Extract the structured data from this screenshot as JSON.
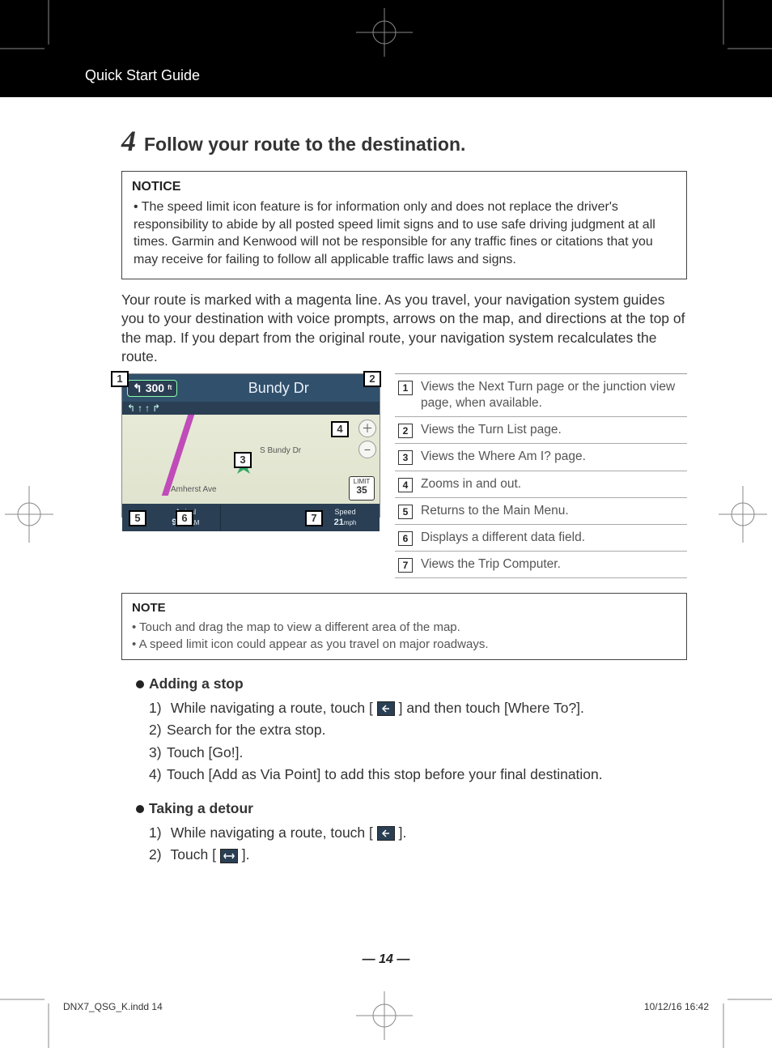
{
  "header": {
    "section": "Quick Start Guide"
  },
  "step": {
    "num": "4",
    "title": "Follow your route to the destination."
  },
  "notice": {
    "title": "NOTICE",
    "items": [
      "The speed limit icon feature is for information only and does not replace the driver's responsibility to abide by all posted speed limit signs and to use safe driving judgment at all times. Garmin and Kenwood will not be responsible for any traffic fines or citations that you may receive for failing to follow all applicable traffic laws and signs."
    ]
  },
  "intro": "Your route is marked with a magenta line. As you travel, your navigation system guides you to your destination with voice prompts, arrows on the map, and directions at the top of the map. If you depart from the original route, your navigation system recalculates the route.",
  "map": {
    "distance": "300",
    "distance_unit": "ft",
    "street": "Bundy Dr",
    "road1": "S Bundy Dr",
    "road2": "Amherst Ave",
    "arrival_lbl": "Arrival",
    "arrival_val": "9:13",
    "arrival_ampm": "AM",
    "speed_lbl": "Speed",
    "speed_val": "21",
    "speed_unit": "mph",
    "limit_lbl": "LIMIT",
    "limit_val": "35",
    "callouts": [
      "1",
      "2",
      "3",
      "4",
      "5",
      "6",
      "7"
    ]
  },
  "legend": [
    "Views the Next Turn page or the junction view page, when available.",
    "Views the Turn List page.",
    "Views the Where Am I? page.",
    "Zooms in and out.",
    "Returns to the Main Menu.",
    "Displays a different data field.",
    "Views the Trip Computer."
  ],
  "note": {
    "title": "NOTE",
    "items": [
      "Touch and drag the map to view a different area of the map.",
      "A speed limit icon could appear as you travel on major roadways."
    ]
  },
  "adding_stop": {
    "title": "Adding a stop",
    "steps_pre": "While navigating a route, touch [",
    "steps_post": "] and then touch [Where To?].",
    "s2": "Search for the extra stop.",
    "s3": "Touch [Go!].",
    "s4": "Touch [Add as Via Point] to add this stop before your final destination."
  },
  "detour": {
    "title": "Taking a detour",
    "s1_pre": "While navigating a route, touch [",
    "s1_post": "].",
    "s2_pre": "Touch [",
    "s2_post": "]."
  },
  "page_number": "14",
  "footer": {
    "file": "DNX7_QSG_K.indd   14",
    "stamp": "10/12/16   16:42"
  }
}
